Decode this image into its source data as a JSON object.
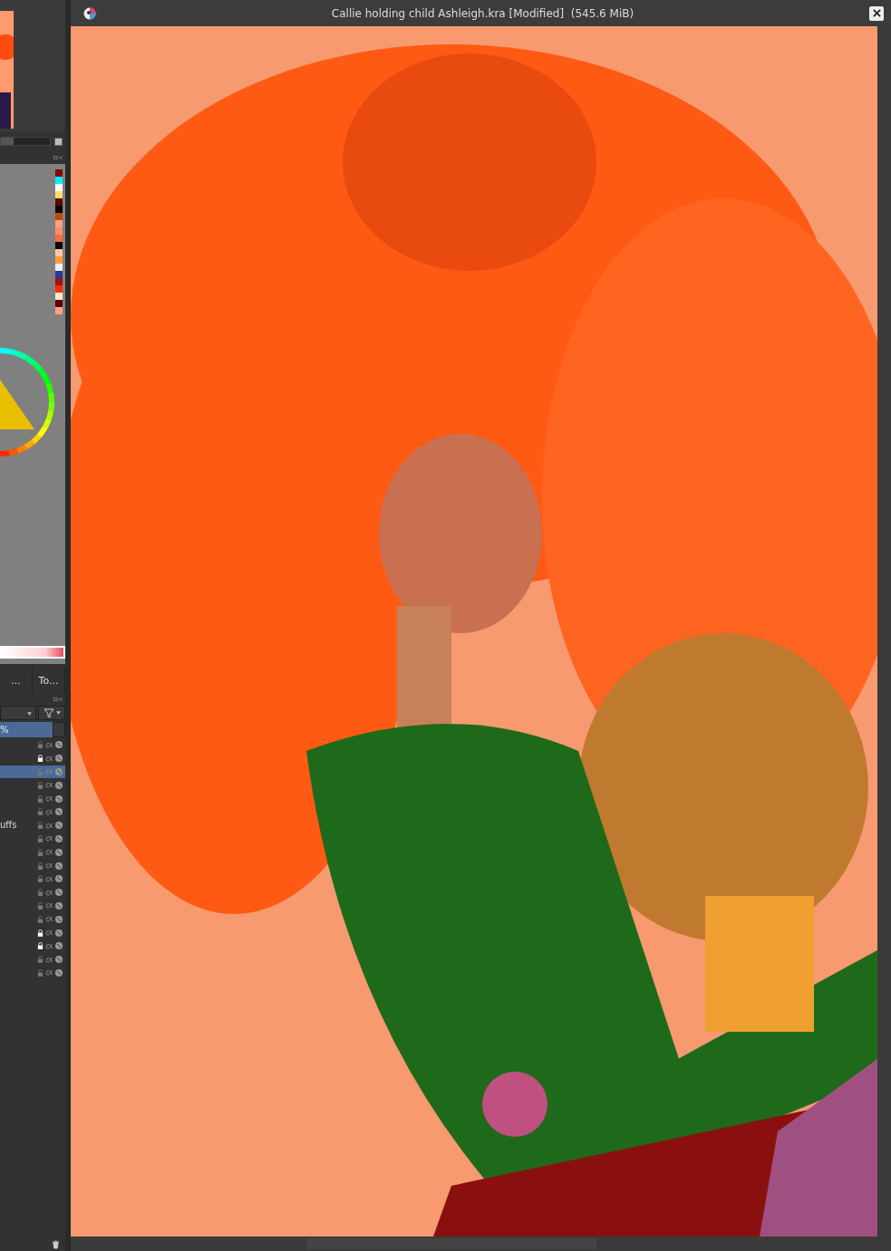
{
  "window": {
    "title": "Callie holding child Ashleigh.kra [Modified]  (545.6 MiB)"
  },
  "palette": [
    {
      "color": "#8b0000"
    },
    {
      "color": "#00eeff"
    },
    {
      "color": "#ffffff"
    },
    {
      "color": "#ffdd66"
    },
    {
      "color": "#5a0a00"
    },
    {
      "color": "#0a0000"
    },
    {
      "color": "#c04a00"
    },
    {
      "color": "#ffa07a"
    },
    {
      "color": "#ff8c6a"
    },
    {
      "color": "#ff6a3a"
    },
    {
      "color": "#050505"
    },
    {
      "color": "#ffc8a0"
    },
    {
      "color": "#ff9a3a"
    },
    {
      "color": "#f0f0ff"
    },
    {
      "color": "#2a3a90"
    },
    {
      "color": "#a01010"
    },
    {
      "color": "#ff2a00"
    },
    {
      "color": "#ffe8c8"
    },
    {
      "color": "#5a0000"
    },
    {
      "color": "#ffa080"
    }
  ],
  "zoom": {
    "level": 0.25
  },
  "dock_tabs": [
    {
      "label": "...",
      "selected": false
    },
    {
      "label": "To...",
      "selected": false
    }
  ],
  "layers_panel": {
    "opacity": "%"
  },
  "layers": [
    {
      "selected": false,
      "locked": false
    },
    {
      "selected": false,
      "locked": true
    },
    {
      "selected": true,
      "locked": false
    },
    {
      "selected": false,
      "locked": false
    },
    {
      "selected": false,
      "locked": false
    },
    {
      "selected": false,
      "locked": false
    },
    {
      "name": "uffs",
      "selected": false,
      "locked": false
    },
    {
      "selected": false,
      "locked": false
    },
    {
      "selected": false,
      "locked": false
    },
    {
      "selected": false,
      "locked": false
    },
    {
      "selected": false,
      "locked": false
    },
    {
      "selected": false,
      "locked": false
    },
    {
      "selected": false,
      "locked": false
    },
    {
      "selected": false,
      "locked": false
    },
    {
      "selected": false,
      "locked": true
    },
    {
      "selected": false,
      "locked": true
    },
    {
      "selected": false,
      "locked": false
    },
    {
      "selected": false,
      "locked": false
    }
  ]
}
